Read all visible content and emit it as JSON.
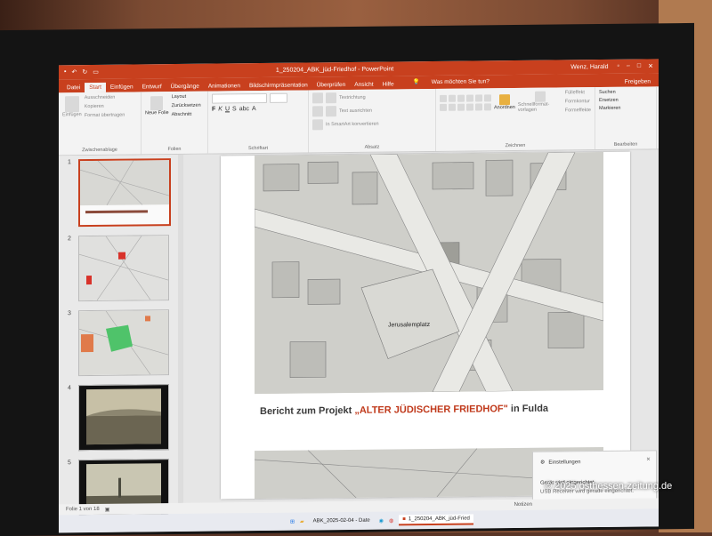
{
  "window": {
    "title": "1_250204_ABK_jüd-Friedhof - PowerPoint",
    "user": "Wenz, Harald"
  },
  "menu": {
    "file": "Datei",
    "start": "Start",
    "insert": "Einfügen",
    "design": "Entwurf",
    "transitions": "Übergänge",
    "animations": "Animationen",
    "slideshow": "Bildschirmpräsentation",
    "review": "Überprüfen",
    "view": "Ansicht",
    "help": "Hilfe",
    "tell": "Was möchten Sie tun?",
    "share": "Freigeben"
  },
  "ribbon": {
    "paste": "Einfügen",
    "cut": "Ausschneiden",
    "copy": "Kopieren",
    "format_painter": "Format übertragen",
    "clipboard": "Zwischenablage",
    "new_slide": "Neue Folie",
    "layout": "Layout",
    "reset": "Zurücksetzen",
    "section": "Abschnitt",
    "slides": "Folien",
    "font": "Schriftart",
    "paragraph": "Absatz",
    "text_direction": "Textrichtung",
    "align_text": "Text ausrichten",
    "smartart": "In SmartArt konvertieren",
    "arrange": "Anordnen",
    "quick_styles": "Schnellformat-vorlagen",
    "shape_fill": "Fülleffekt",
    "shape_outline": "Formkontur",
    "shape_effects": "Formeffekte",
    "drawing": "Zeichnen",
    "find": "Suchen",
    "replace": "Ersetzen",
    "select": "Markieren",
    "editing": "Bearbeiten"
  },
  "thumbnails": [
    "1",
    "2",
    "3",
    "4",
    "5"
  ],
  "slide": {
    "title_prefix": "Bericht zum Projekt ",
    "title_highlight": "„ALTER JÜDISCHER FRIEDHOF\"",
    "title_suffix": " in Fulda",
    "map_label": "Jerusalemplatz"
  },
  "toast": {
    "header": "Einstellungen",
    "line1": "Gerät wird eingerichtet.",
    "line2": "USB Receiver wird gerade eingerichtet."
  },
  "status": {
    "slide_counter": "Folie 1 von 18",
    "notes": "Notizen"
  },
  "taskbar": {
    "item1": "ABK_2025-02-04 - Date",
    "item2": "1_250204_ABK_jüd-Fried"
  },
  "watermark": "© 2025 osthessen-zeitung.de",
  "colors": {
    "accent": "#c8401e",
    "highlight": "#c0391b"
  }
}
